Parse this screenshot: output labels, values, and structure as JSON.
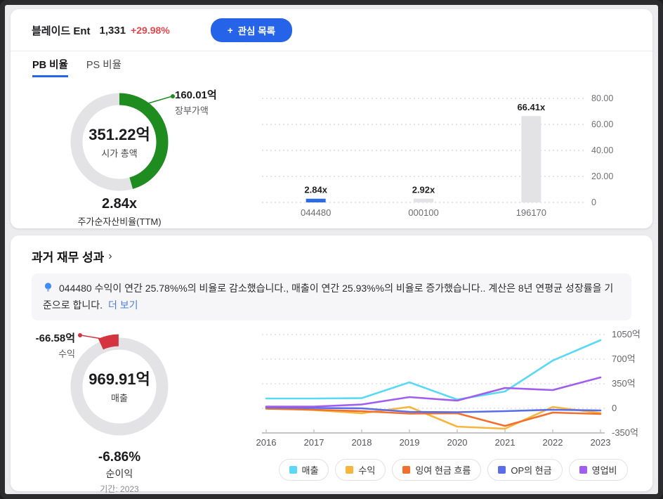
{
  "header": {
    "title": "블레이드 Ent",
    "price": "1,331",
    "change": "+29.98%",
    "watchlist": {
      "icon": "+",
      "label": "관심 목록"
    }
  },
  "tabs": [
    {
      "label": "PB 비율",
      "active": true
    },
    {
      "label": "PS 비율",
      "active": false
    }
  ],
  "pb": {
    "donut": {
      "center_value": "351.22억",
      "center_label": "시가 총액",
      "callout_value": "160.01억",
      "callout_label": "장부가액",
      "ratio_value": "2.84x",
      "ratio_label": "주가순자산비율(TTM)",
      "fraction": 0.4556,
      "arc_color": "#1f8c1f",
      "ring_color": "#e3e3e5"
    }
  },
  "history": {
    "title": "과거 재무 성과",
    "chevron": "›",
    "insight": {
      "text": "044480 수익이 연간 25.78%%의 비율로 감소했습니다., 매출이 연간 25.93%%의 비율로 증가했습니다.. 계산은 8년 연평균 성장률을 기준으로 합니다.",
      "link_label": "더 보기"
    },
    "donut": {
      "center_value": "969.91억",
      "center_label": "매출",
      "callout_value": "-66.58억",
      "callout_label": "수익",
      "ratio_value": "-6.86%",
      "ratio_label": "순이익",
      "period": "기간: 2023",
      "fraction": 0.0686,
      "wedge_color": "#d4343f",
      "ring_color": "#e3e3e5"
    }
  },
  "colors": {
    "accent_blue": "#2563e8",
    "change_red": "#e5464e",
    "link_blue": "#4a7ee0"
  },
  "chart_data": [
    {
      "type": "bar",
      "title": "",
      "categories": [
        "044480",
        "000100",
        "196170"
      ],
      "values": [
        2.84,
        2.92,
        66.41
      ],
      "value_labels": [
        "2.84x",
        "2.92x",
        "66.41x"
      ],
      "bar_colors": [
        "#2e6be0",
        "#e3e3e5",
        "#e3e3e5"
      ],
      "ylim": [
        0,
        80
      ],
      "yticks": [
        {
          "label": "80.00",
          "value": 80
        },
        {
          "label": "60.00",
          "value": 60
        },
        {
          "label": "40.00",
          "value": 40
        },
        {
          "label": "20.00",
          "value": 20
        },
        {
          "label": "0",
          "value": 0
        }
      ],
      "grid": true,
      "ytick_side": "right"
    },
    {
      "type": "line",
      "title": "",
      "x": [
        "2016",
        "2017",
        "2018",
        "2019",
        "2020",
        "2021",
        "2022",
        "2023"
      ],
      "series": [
        {
          "name": "매출",
          "color": "#5bd8f4",
          "values": [
            140,
            140,
            145,
            370,
            125,
            240,
            680,
            970
          ]
        },
        {
          "name": "수익",
          "color": "#f6b63c",
          "values": [
            5,
            -25,
            -70,
            20,
            -260,
            -290,
            20,
            -67
          ]
        },
        {
          "name": "잉여 현금 흐름",
          "color": "#f0702e",
          "values": [
            -5,
            -20,
            -40,
            -75,
            -70,
            -250,
            -60,
            -80
          ]
        },
        {
          "name": "OP의 현금",
          "color": "#5a6de8",
          "values": [
            15,
            5,
            0,
            -50,
            -55,
            -40,
            -20,
            -30
          ]
        },
        {
          "name": "영업비",
          "color": "#a15ded",
          "values": [
            25,
            25,
            55,
            160,
            110,
            290,
            260,
            440
          ]
        }
      ],
      "ylim": [
        -350,
        1050
      ],
      "yticks": [
        {
          "label": "1050억",
          "value": 1050
        },
        {
          "label": "700억",
          "value": 700
        },
        {
          "label": "350억",
          "value": 350
        },
        {
          "label": "0",
          "value": 0
        },
        {
          "label": "-350억",
          "value": -350
        }
      ],
      "grid": true,
      "legend_position": "bottom",
      "ytick_side": "right"
    }
  ]
}
